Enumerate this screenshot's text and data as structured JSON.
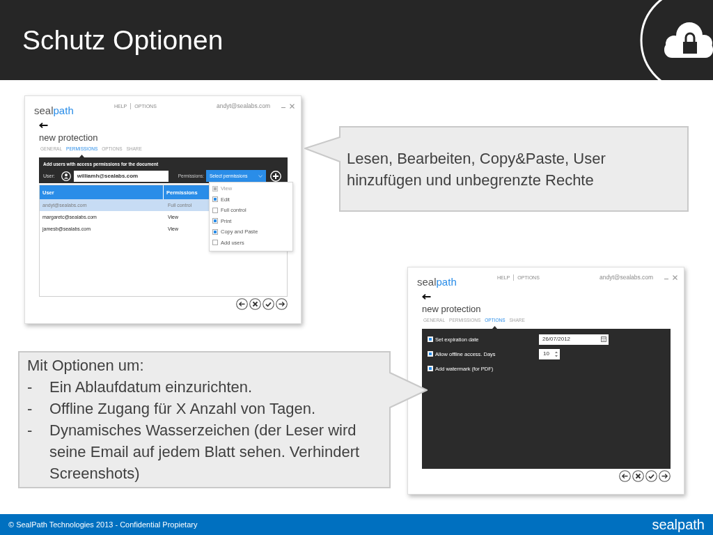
{
  "header": {
    "title": "Schutz Optionen"
  },
  "screenshots": [
    {
      "kind": "permissions",
      "logo": {
        "text": "seal",
        "accent": "path"
      },
      "menu": [
        {
          "label": "HELP"
        },
        {
          "label": "OPTIONS"
        }
      ],
      "account": "andyt@sealabs.com",
      "heading": "new protection",
      "tabs": [
        {
          "label": "GENERAL",
          "selected": false
        },
        {
          "label": "PERMISSIONS",
          "selected": true
        },
        {
          "label": "OPTIONS",
          "selected": false
        },
        {
          "label": "SHARE",
          "selected": false
        }
      ],
      "panel": {
        "caption": "Add users with access permissions for the document",
        "user_label": "User:",
        "user_value": "williamh@sealabs.com",
        "permissions_label": "Permissions:",
        "permissions_value": "Select permissions"
      },
      "table": {
        "columns": [
          "User",
          "Permissions"
        ],
        "rows": [
          {
            "cells": [
              "andyt@sealabs.com",
              "Full control"
            ],
            "selected": true
          },
          {
            "cells": [
              "margaretc@sealabs.com",
              "View"
            ],
            "selected": false
          },
          {
            "cells": [
              "jamesb@sealabs.com",
              "View"
            ],
            "selected": false
          }
        ]
      },
      "dropdown": [
        {
          "label": "View",
          "checked": true,
          "disabled": true
        },
        {
          "label": "Edit",
          "checked": true,
          "disabled": false
        },
        {
          "label": "Full control",
          "checked": false,
          "disabled": false
        },
        {
          "label": "Print",
          "checked": true,
          "disabled": false
        },
        {
          "label": "Copy and Paste",
          "checked": true,
          "disabled": false
        },
        {
          "label": "Add users",
          "checked": false,
          "disabled": false
        }
      ]
    },
    {
      "kind": "options",
      "logo": {
        "text": "seal",
        "accent": "path"
      },
      "menu": [
        {
          "label": "HELP"
        },
        {
          "label": "OPTIONS"
        }
      ],
      "account": "andyt@sealabs.com",
      "heading": "new protection",
      "tabs": [
        {
          "label": "GENERAL",
          "selected": false
        },
        {
          "label": "PERMISSIONS",
          "selected": false
        },
        {
          "label": "OPTIONS",
          "selected": true
        },
        {
          "label": "SHARE",
          "selected": false
        }
      ],
      "options": [
        {
          "label": "Set expiration date",
          "checked": true,
          "field": {
            "kind": "date",
            "value": "26/07/2012"
          }
        },
        {
          "label": "Allow offline access. Days",
          "checked": true,
          "field": {
            "kind": "number",
            "value": "10"
          }
        },
        {
          "label": "Add watermark (for PDF)",
          "checked": true
        }
      ]
    }
  ],
  "callouts": [
    {
      "kind": "text",
      "text": "Lesen, Bearbeiten, Copy&Paste, User hinzufügen und unbegrenzte Rechte"
    },
    {
      "kind": "list",
      "intro": "Mit Optionen um:",
      "items": [
        {
          "bullet": "-",
          "text": "Ein Ablaufdatum einzurichten."
        },
        {
          "bullet": "-",
          "text": "Offline Zugang für X Anzahl von Tagen."
        },
        {
          "bullet": "-",
          "text": "Dynamisches Wasserzeichen (der Leser wird seine Email auf jedem Blatt sehen. Verhindert Screenshots)"
        }
      ]
    }
  ],
  "footer": {
    "copyright": "© SealPath Technologies 2013 - Confidential Propietary",
    "logo": "sealpath"
  }
}
